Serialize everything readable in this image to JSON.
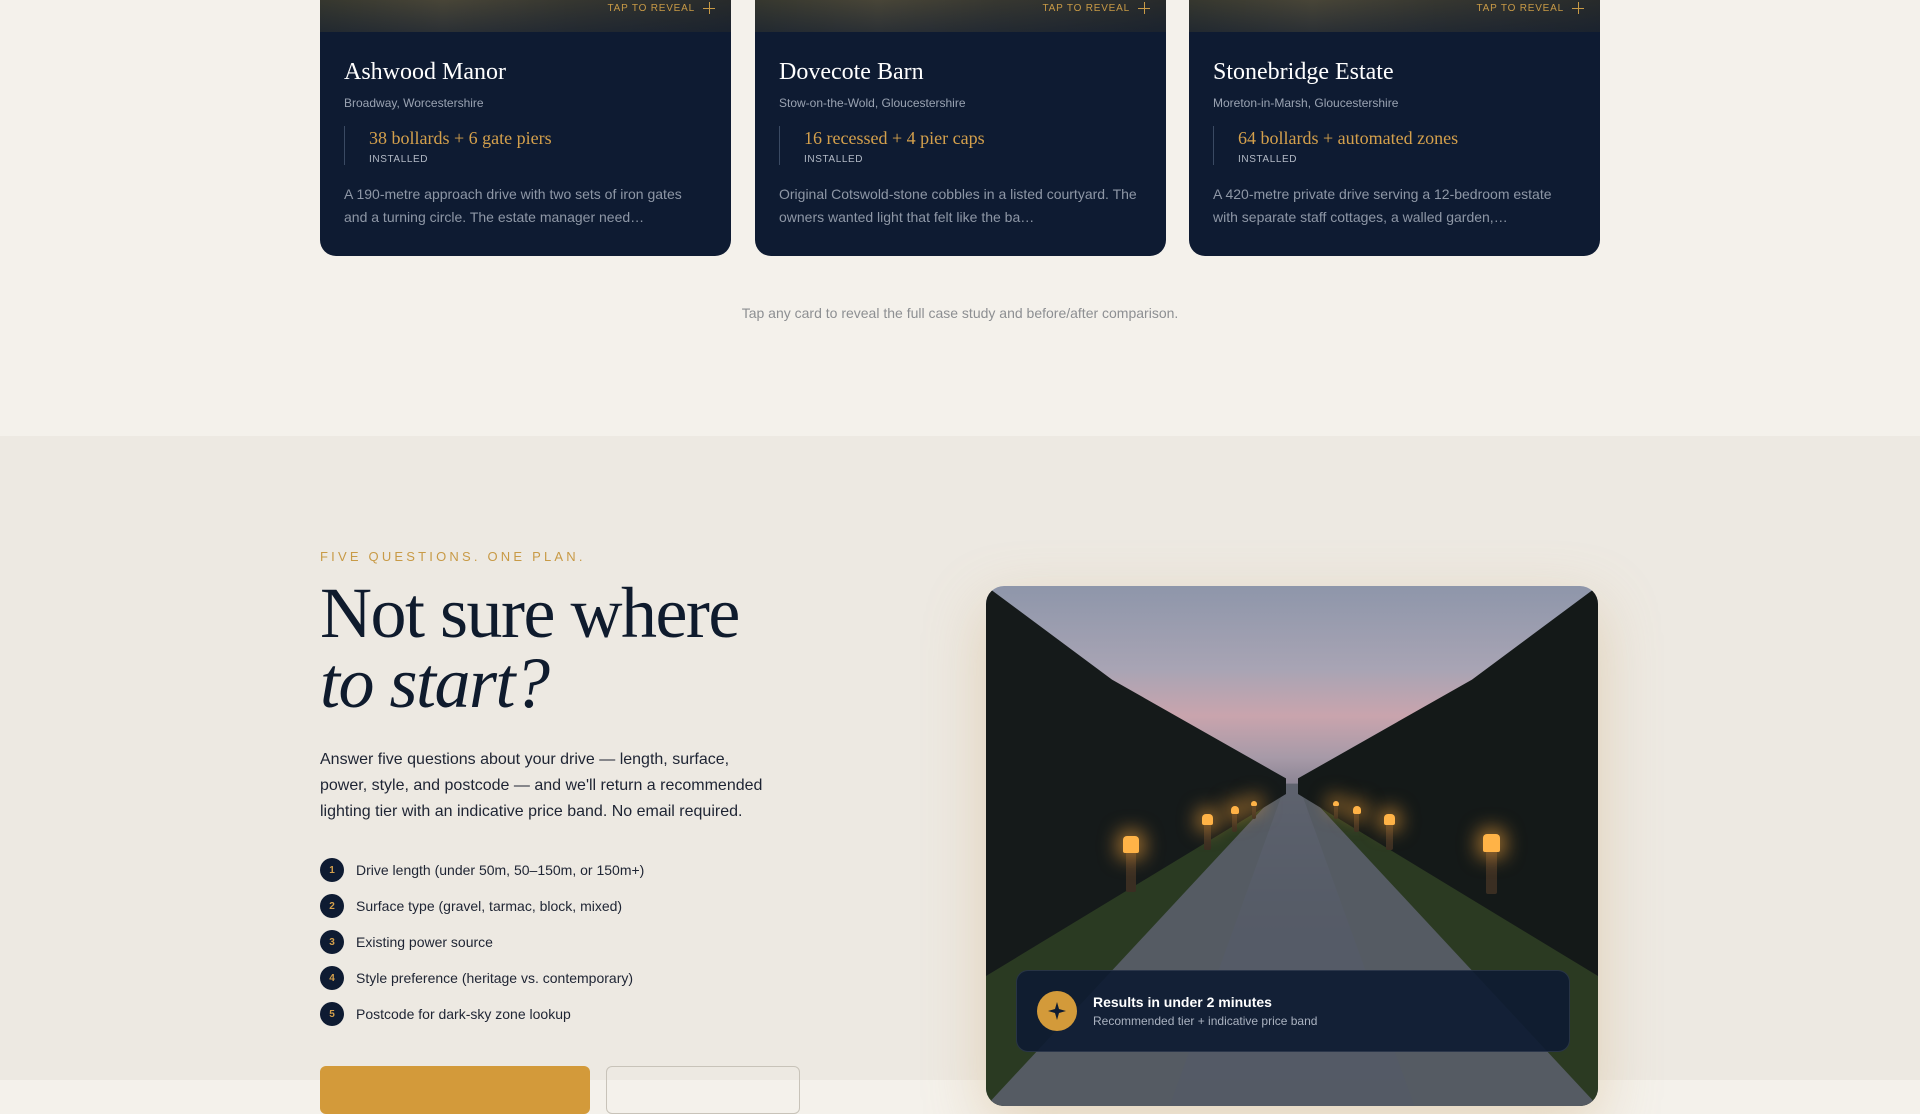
{
  "case_studies": {
    "reveal_label": "TAP TO REVEAL",
    "cards": [
      {
        "title": "Ashwood Manor",
        "location": "Broadway, Worcestershire",
        "stat": "38 bollards + 6 gate piers",
        "stat_label": "INSTALLED",
        "description": "A 190-metre approach drive with two sets of iron gates and a turning circle. The estate manager need…"
      },
      {
        "title": "Dovecote Barn",
        "location": "Stow-on-the-Wold, Gloucestershire",
        "stat": "16 recessed + 4 pier caps",
        "stat_label": "INSTALLED",
        "description": "Original Cotswold-stone cobbles in a listed courtyard. The owners wanted light that felt like the ba…"
      },
      {
        "title": "Stonebridge Estate",
        "location": "Moreton-in-Marsh, Gloucestershire",
        "stat": "64 bollards + automated zones",
        "stat_label": "INSTALLED",
        "description": "A 420-metre private drive serving a 12-bedroom estate with separate staff cottages, a walled garden,…"
      }
    ],
    "hint": "Tap any card to reveal the full case study and before/after comparison."
  },
  "planner": {
    "eyebrow": "FIVE QUESTIONS. ONE PLAN.",
    "headline_line1": "Not sure where",
    "headline_line2": "to start?",
    "lede": "Answer five questions about your drive — length, surface, power, style, and postcode — and we'll return a recommended lighting tier with an indicative price band. No email required.",
    "steps": [
      {
        "num": "1",
        "text": "Drive length (under 50m, 50–150m, or 150m+)"
      },
      {
        "num": "2",
        "text": "Surface type (gravel, tarmac, block, mixed)"
      },
      {
        "num": "3",
        "text": "Existing power source"
      },
      {
        "num": "4",
        "text": "Style preference (heritage vs. contemporary)"
      },
      {
        "num": "5",
        "text": "Postcode for dark-sky zone lookup"
      }
    ],
    "results": {
      "title": "Results in under 2 minutes",
      "subtitle": "Recommended tier + indicative price band",
      "icon": "sparkle-icon"
    }
  },
  "colors": {
    "navy": "#0e1b32",
    "gold": "#d39a3a",
    "background": "#f4f1eb"
  }
}
